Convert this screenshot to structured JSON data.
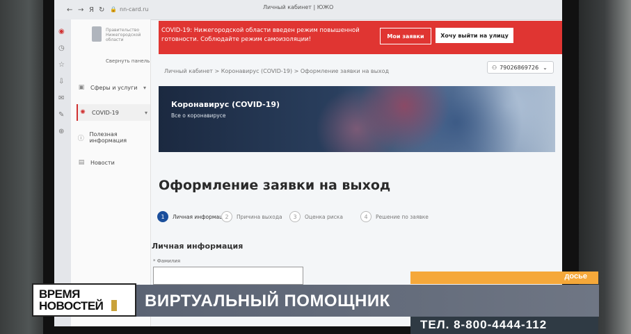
{
  "browser": {
    "window_title": "Личный кабинет | ЮЖО",
    "url": "nn-card.ru"
  },
  "sidebar": {
    "logo_text": "Правительство Нижегородской области",
    "collapse_label": "Свернуть панель",
    "items": [
      {
        "label": "Сферы и услуги",
        "icon": "folder-icon"
      },
      {
        "label": "COVID-19",
        "icon": "covid-icon",
        "active": true
      },
      {
        "label": "Полезная информация",
        "icon": "info-icon"
      },
      {
        "label": "Новости",
        "icon": "news-icon"
      }
    ]
  },
  "alert": {
    "text": "COVID-19: Нижегородской области введен режим повышенной готовности. Соблюдайте режим самоизоляции!",
    "primary_button": "Мои заявки",
    "secondary_button": "Хочу выйти на улицу",
    "color": "#e03532"
  },
  "breadcrumb": "Личный кабинет > Коронавирус (COVID-19) > Оформление заявки на выход",
  "user": {
    "phone": "79026869726"
  },
  "banner": {
    "title": "Коронавирус (COVID-19)",
    "subtitle": "Все о коронавирусе"
  },
  "page_title": "Оформление заявки на выход",
  "steps": [
    {
      "num": "1",
      "label": "Личная информация",
      "current": true
    },
    {
      "num": "2",
      "label": "Причина выхода"
    },
    {
      "num": "3",
      "label": "Оценка риска"
    },
    {
      "num": "4",
      "label": "Решение по заявке"
    }
  ],
  "form": {
    "section_title": "Личная информация",
    "surname_label": "* Фамилия",
    "surname_value": ""
  },
  "tv": {
    "channel_line1": "ВРЕМЯ",
    "channel_line2": "НОВОСТЕЙ",
    "dossier": "досье",
    "headline": "ВИРТУАЛЬНЫЙ ПОМОЩНИК",
    "phone": "ТЕЛ. 8-800-4444-112",
    "accent_color": "#f5a83a"
  }
}
